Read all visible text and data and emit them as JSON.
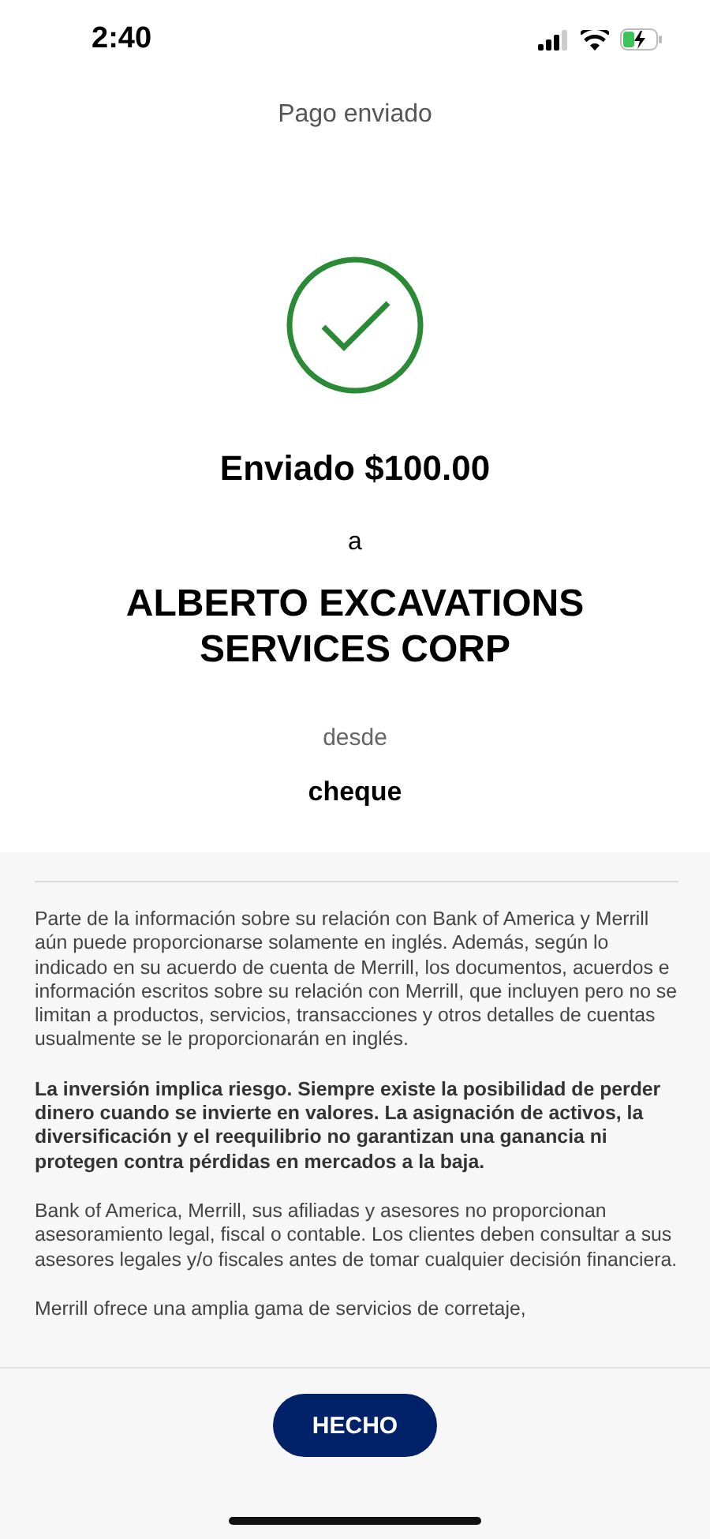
{
  "status_bar": {
    "time": "2:40"
  },
  "header": {
    "title": "Pago enviado"
  },
  "confirmation": {
    "amount_line": "Enviado $100.00",
    "to_label": "a",
    "payee": "ALBERTO EXCAVATIONS SERVICES CORP",
    "from_label": "desde",
    "account": "cheque"
  },
  "disclosures": [
    {
      "emphasis": false,
      "text": "Parte de la información sobre su relación con Bank of America y Merrill aún puede proporcionarse solamente en inglés. Además, según lo indicado en su acuerdo de cuenta de Merrill, los documentos, acuerdos e información escritos sobre su relación con Merrill, que incluyen pero no se limitan a productos, servicios, transacciones y otros detalles de cuentas usualmente se le proporcionarán en inglés."
    },
    {
      "emphasis": true,
      "text": "La inversión implica riesgo. Siempre existe la posibilidad de perder dinero cuando se invierte en valores. La asignación de activos, la diversificación y el reequilibrio no garantizan una ganancia ni protegen contra pérdidas en mercados a la baja."
    },
    {
      "emphasis": false,
      "text": "Bank of America, Merrill, sus afiliadas y asesores no proporcionan asesoramiento legal, fiscal o contable. Los clientes deben consultar a sus asesores legales y/o fiscales antes de tomar cualquier decisión financiera."
    },
    {
      "emphasis": false,
      "text": "Merrill ofrece una amplia gama de servicios de corretaje,"
    }
  ],
  "footer": {
    "button": "HECHO"
  }
}
